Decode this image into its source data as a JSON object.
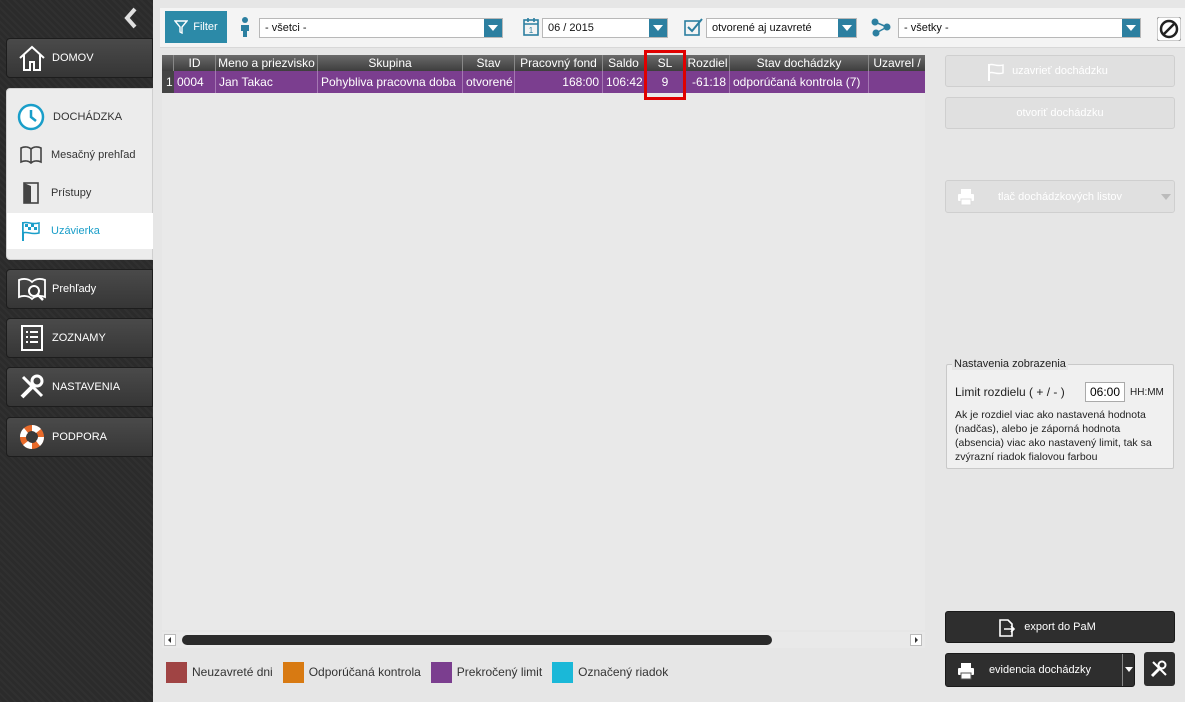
{
  "sidebar": {
    "home": "DOMOV",
    "attendance": "DOCHÁDZKA",
    "monthly": "Mesačný prehľad",
    "access": "Prístupy",
    "closure": "Uzávierka",
    "overviews": "Prehľady",
    "lists": "ZOZNAMY",
    "settings": "NASTAVENIA",
    "support": "PODPORA"
  },
  "toolbar": {
    "filter_label": "Filter",
    "employee": "- všetci -",
    "period": "06 / 2015",
    "status": "otvorené aj uzavreté",
    "group": "- všetky -"
  },
  "grid": {
    "columns": [
      "ID",
      "Meno a priezvisko",
      "Skupina",
      "Stav",
      "Pracovný fond",
      "Saldo",
      "SL",
      "Rozdiel",
      "Stav dochádzky",
      "Uzavrel /"
    ],
    "rows": [
      {
        "num": "1",
        "id": "0004",
        "name": "Jan Takac",
        "group": "Pohybliva pracovna doba",
        "state": "otvorené",
        "fund": "168:00",
        "saldo": "106:42",
        "sl": "9",
        "diff": "-61:18",
        "att_state": "odporúčaná kontrola (7)",
        "closed_by": ""
      }
    ],
    "row_color": "#7b3e8f"
  },
  "legend": [
    {
      "label": "Neuzavreté dni",
      "color": "#a04444"
    },
    {
      "label": "Odporúčaná kontrola",
      "color": "#d87a12"
    },
    {
      "label": "Prekročený limit",
      "color": "#7b3e8f"
    },
    {
      "label": "Označený riadok",
      "color": "#1ab8d8"
    }
  ],
  "actions": {
    "close": "uzavrieť dochádzku",
    "open": "otvoriť dochádzku",
    "print": "tlač dochádzkových listov",
    "export": "export do PaM",
    "evidence": "evidencia dochádzky"
  },
  "display_settings": {
    "title": "Nastavenia zobrazenia",
    "limit_label": "Limit rozdielu ( + / - )",
    "limit_value": "06:00",
    "unit": "HH:MM",
    "description": "Ak je rozdiel viac ako nastavená hodnota (nadčas), alebo je záporná hodnota (absencia) viac ako nastavený limit, tak sa zvýrazní riadok fialovou farbou"
  },
  "accent": "#2c8aa8"
}
